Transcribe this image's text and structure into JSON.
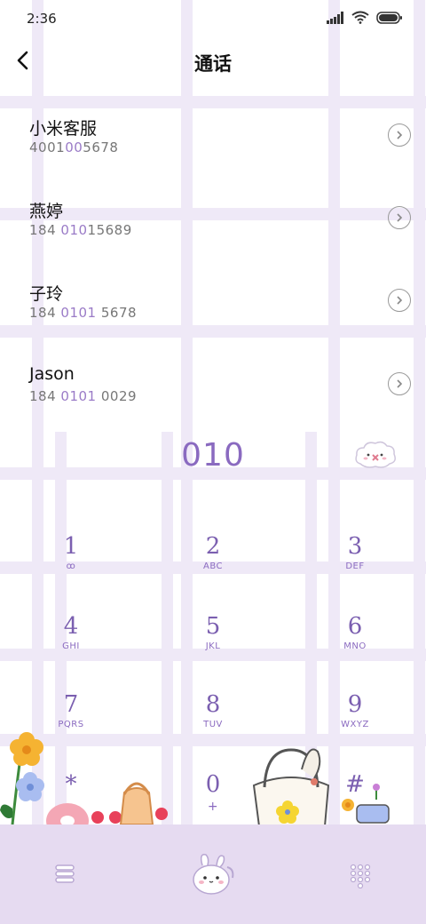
{
  "status": {
    "time": "2:36"
  },
  "header": {
    "title": "通话"
  },
  "contacts": [
    {
      "name": "小米客服",
      "num_pre": "4001",
      "num_hl": "",
      "num_post": "005678",
      "num_full_hl": "010",
      "display": "4001005678"
    },
    {
      "name": "燕婷",
      "num_pre": "184 ",
      "num_hl": "010",
      "num_post": "15689"
    },
    {
      "name": "子玲",
      "num_pre": "184 ",
      "num_hl": "0101",
      "num_post": " 5678"
    },
    {
      "name": "Jason",
      "num_pre": "184 ",
      "num_hl": "0101",
      "num_post": " 0029"
    }
  ],
  "dialer": {
    "input": "010",
    "keys": [
      {
        "digit": "1",
        "letters": "ꝏ"
      },
      {
        "digit": "2",
        "letters": "ABC"
      },
      {
        "digit": "3",
        "letters": "DEF"
      },
      {
        "digit": "4",
        "letters": "GHI"
      },
      {
        "digit": "5",
        "letters": "JKL"
      },
      {
        "digit": "6",
        "letters": "MNO"
      },
      {
        "digit": "7",
        "letters": "PQRS"
      },
      {
        "digit": "8",
        "letters": "TUV"
      },
      {
        "digit": "9",
        "letters": "WXYZ"
      },
      {
        "digit": "*",
        "letters": ""
      },
      {
        "digit": "0",
        "letters": "+"
      },
      {
        "digit": "#",
        "letters": ""
      }
    ]
  },
  "colors": {
    "accent": "#8a6ac0",
    "grid": "#efe9f7",
    "bar": "#e6dbf1"
  }
}
